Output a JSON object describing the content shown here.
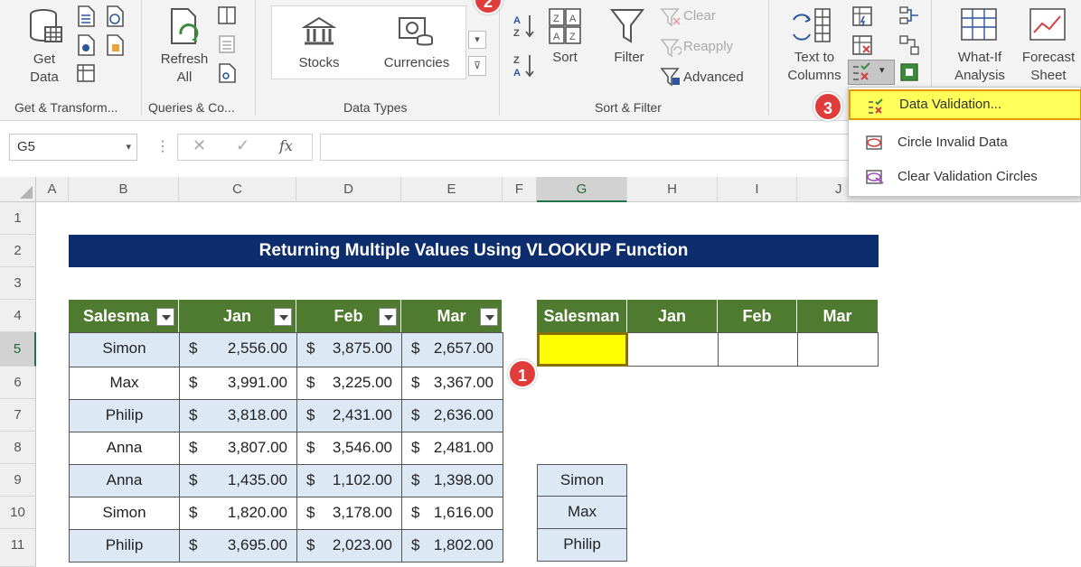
{
  "ribbon": {
    "get_data": "Get Data",
    "refresh_all": "Refresh All",
    "stocks": "Stocks",
    "currencies": "Currencies",
    "sort": "Sort",
    "filter": "Filter",
    "clear": "Clear",
    "reapply": "Reapply",
    "advanced": "Advanced",
    "text_to_columns": "Text to Columns",
    "what_if": "What-If Analysis",
    "forecast_sheet": "Forecast Sheet",
    "groups": {
      "get_transform": "Get & Transform...",
      "queries": "Queries & Co...",
      "data_types": "Data Types",
      "sort_filter": "Sort & Filter"
    }
  },
  "formula_bar": {
    "name_box": "G5",
    "fx": "fx"
  },
  "dropdown_menu": {
    "items": [
      "Data Validation...",
      "Circle Invalid Data",
      "Clear Validation Circles"
    ]
  },
  "columns": [
    "A",
    "B",
    "C",
    "D",
    "E",
    "F",
    "G",
    "H",
    "I",
    "J"
  ],
  "rows": [
    "1",
    "2",
    "3",
    "4",
    "5",
    "6",
    "7",
    "8",
    "9",
    "10",
    "11"
  ],
  "sheet": {
    "title": "Returning Multiple Values Using VLOOKUP Function",
    "left_table": {
      "headers": [
        "Salesma",
        "Jan",
        "Feb",
        "Mar"
      ],
      "currency": "$",
      "rows": [
        {
          "name": "Simon",
          "jan": "2,556.00",
          "feb": "3,875.00",
          "mar": "2,657.00"
        },
        {
          "name": "Max",
          "jan": "3,991.00",
          "feb": "3,225.00",
          "mar": "3,367.00"
        },
        {
          "name": "Philip",
          "jan": "3,818.00",
          "feb": "2,431.00",
          "mar": "2,636.00"
        },
        {
          "name": "Anna",
          "jan": "3,807.00",
          "feb": "3,546.00",
          "mar": "2,481.00"
        },
        {
          "name": "Anna",
          "jan": "1,435.00",
          "feb": "1,102.00",
          "mar": "1,398.00"
        },
        {
          "name": "Simon",
          "jan": "1,820.00",
          "feb": "3,178.00",
          "mar": "1,616.00"
        },
        {
          "name": "Philip",
          "jan": "3,695.00",
          "feb": "2,023.00",
          "mar": "1,802.00"
        }
      ]
    },
    "right_table": {
      "headers": [
        "Salesman",
        "Jan",
        "Feb",
        "Mar"
      ]
    },
    "name_list": [
      "Simon",
      "Max",
      "Philip"
    ]
  },
  "callouts": [
    "1",
    "2",
    "3"
  ],
  "colors": {
    "title_bg": "#0e2d6d",
    "header_bg": "#4e7b2f",
    "alt_row": "#dde8f5",
    "selected_cell": "#ffff00",
    "badge": "#e03c3c"
  }
}
